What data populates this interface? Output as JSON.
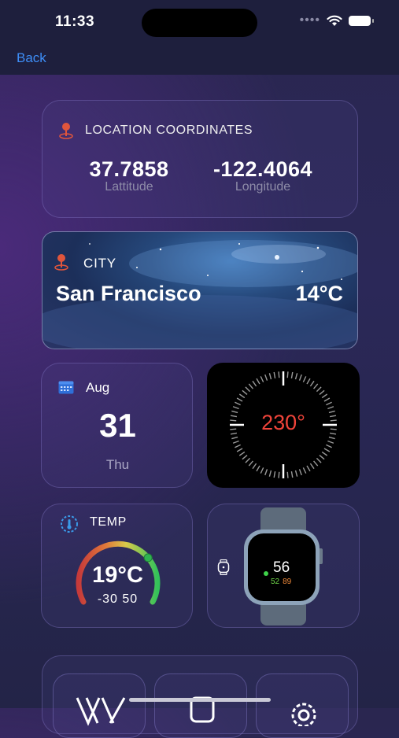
{
  "status_bar": {
    "time": "11:33"
  },
  "nav": {
    "back_label": "Back"
  },
  "location": {
    "title": "LOCATION COORDINATES",
    "latitude": "37.7858",
    "latitude_label": "Lattitude",
    "longitude": "-122.4064",
    "longitude_label": "Longitude"
  },
  "city": {
    "title": "CITY",
    "name": "San Francisco",
    "temp": "14°C"
  },
  "date": {
    "month": "Aug",
    "day": "31",
    "weekday": "Thu"
  },
  "compass": {
    "heading": "230°"
  },
  "temperature": {
    "title": "TEMP",
    "value": "19°C",
    "range": "-30  50",
    "level": 0.71
  },
  "watch": {
    "heart_rate": "56",
    "low": "52",
    "high": "89"
  },
  "bottom_menu": {
    "icons": [
      "app-logo-icon",
      "watch-icon",
      "gear-icon"
    ]
  },
  "colors": {
    "accent": "#3e8ef7",
    "heading": "#f0443a",
    "pin": "#e0553c"
  }
}
